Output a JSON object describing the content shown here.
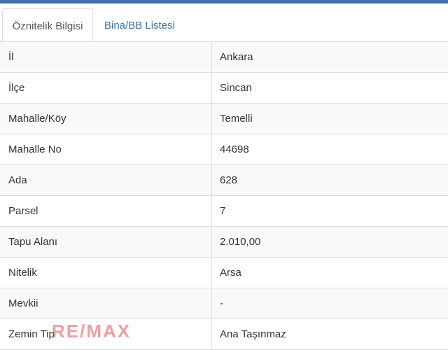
{
  "tabs": [
    {
      "label": "Öznitelik Bilgisi",
      "active": true
    },
    {
      "label": "Bina/BB Listesi",
      "active": false
    }
  ],
  "rows": [
    {
      "key": "İl",
      "value": "Ankara"
    },
    {
      "key": "İlçe",
      "value": "Sincan"
    },
    {
      "key": "Mahalle/Köy",
      "value": "Temelli"
    },
    {
      "key": "Mahalle No",
      "value": "44698"
    },
    {
      "key": "Ada",
      "value": "628"
    },
    {
      "key": "Parsel",
      "value": "7"
    },
    {
      "key": "Tapu Alanı",
      "value": "2.010,00"
    },
    {
      "key": "Nitelik",
      "value": "Arsa"
    },
    {
      "key": "Mevkii",
      "value": "-"
    },
    {
      "key": "Zemin Tip",
      "value": "Ana Taşınmaz"
    }
  ],
  "watermark": "RE/MAX",
  "colors": {
    "accent": "#3d72a8",
    "link": "#3a74b0",
    "border": "#dddddd",
    "stripe": "#f9f9f9"
  }
}
